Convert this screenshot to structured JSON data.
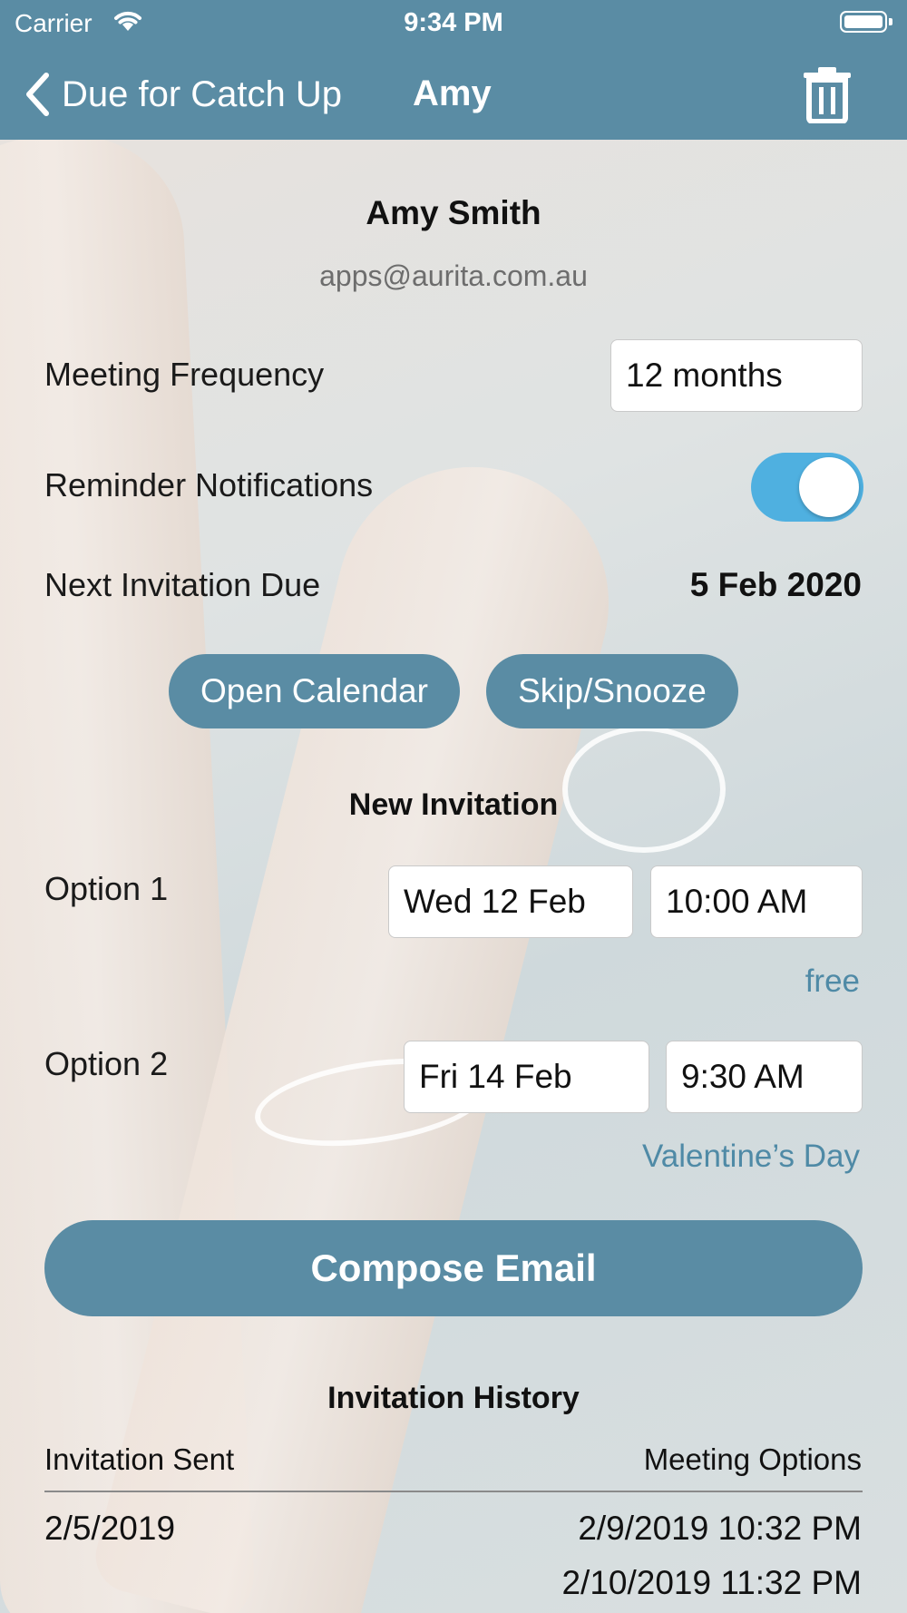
{
  "status_bar": {
    "carrier": "Carrier",
    "time": "9:34 PM"
  },
  "nav": {
    "back_label": "Due for Catch Up",
    "title": "Amy"
  },
  "contact": {
    "name": "Amy Smith",
    "email": "apps@aurita.com.au"
  },
  "settings": {
    "frequency_label": "Meeting Frequency",
    "frequency_value": "12 months",
    "reminder_label": "Reminder Notifications",
    "reminder_on": true,
    "next_due_label": "Next Invitation Due",
    "next_due_value": "5 Feb 2020"
  },
  "actions": {
    "open_calendar": "Open Calendar",
    "skip_snooze": "Skip/Snooze"
  },
  "new_invitation": {
    "title": "New Invitation",
    "options": [
      {
        "label": "Option 1",
        "date": "Wed 12 Feb",
        "time": "10:00 AM",
        "note": "free"
      },
      {
        "label": "Option 2",
        "date": "Fri 14 Feb",
        "time": "9:30 AM",
        "note": "Valentine’s Day"
      }
    ]
  },
  "compose_label": "Compose Email",
  "history": {
    "title": "Invitation History",
    "col_sent": "Invitation Sent",
    "col_options": "Meeting Options",
    "rows": [
      {
        "sent": "2/5/2019",
        "options": [
          "2/9/2019 10:32 PM",
          "2/10/2019 11:32 PM"
        ]
      }
    ]
  },
  "colors": {
    "bar": "#5a8ca4",
    "toggle": "#4fb0e0",
    "note": "#4f8aa6"
  }
}
